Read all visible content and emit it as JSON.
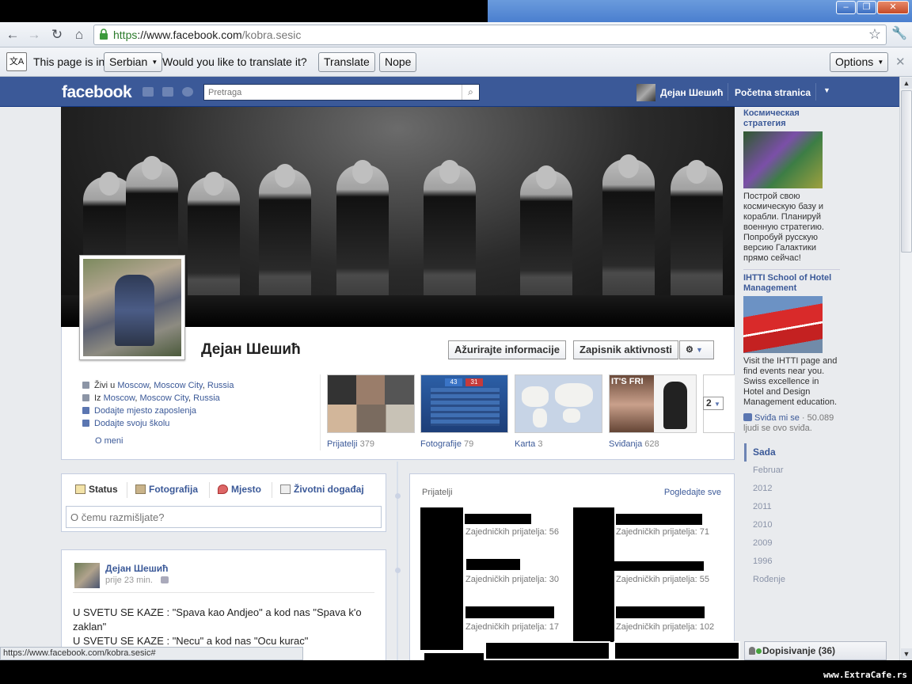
{
  "browser": {
    "url_scheme": "https",
    "url_sep": "://",
    "url_domain": "www.facebook.com",
    "url_path": "/kobra.sesic",
    "status_url": "https://www.facebook.com/kobra.sesic#"
  },
  "translate_bar": {
    "prefix": "This page is in",
    "language": "Serbian",
    "question": "Would you like to translate it?",
    "translate_label": "Translate",
    "nope_label": "Nope",
    "options_label": "Options"
  },
  "fb_header": {
    "logo": "facebook",
    "search_placeholder": "Pretraga",
    "user_name": "Дејан Шешић",
    "home_label": "Početna stranica"
  },
  "profile": {
    "name": "Дејан Шешић",
    "update_info_label": "Ažurirajte informacije",
    "activity_log_label": "Zapisnik aktivnosti",
    "lives_prefix": "Živi u",
    "lives_city": "Moscow",
    "lives_region": "Moscow City",
    "lives_country": "Russia",
    "from_prefix": "Iz",
    "from_city": "Moscow",
    "from_region": "Moscow City",
    "from_country": "Russia",
    "add_work": "Dodajte mjesto zaposlenja",
    "add_school": "Dodajte svoju školu",
    "about_link": "O meni",
    "tiles": [
      {
        "label": "Prijatelji",
        "count": "379"
      },
      {
        "label": "Fotografije",
        "count": "79"
      },
      {
        "label": "Karta",
        "count": "3"
      },
      {
        "label": "Sviđanja",
        "count": "628"
      }
    ],
    "more_count": "2",
    "photo_tile_score_a": "43",
    "photo_tile_score_b": "31",
    "likes_tile_text": "IT'S FRI"
  },
  "composer": {
    "tab_status": "Status",
    "tab_photo": "Fotografija",
    "tab_place": "Mjesto",
    "tab_event": "Životni događaj",
    "placeholder": "O čemu razmišljate?"
  },
  "post": {
    "author": "Дејан Шешић",
    "time": "prije 23 min.",
    "line1": "U SVETU SE KAZE : \"Spava kao Andjeo\" a kod nas \"Spava k'o zaklan\"",
    "line2": "U SVETU SE KAZE : \"Necu\" a kod nas \"Ocu kurac\""
  },
  "friends_box": {
    "title": "Prijatelji",
    "see_all": "Pogledajte sve",
    "mutual": [
      "Zajedničkih prijatelja: 56",
      "Zajedničkih prijatelja: 71",
      "Zajedničkih prijatelja: 30",
      "Zajedničkih prijatelja: 55",
      "Zajedničkih prijatelja: 17",
      "Zajedničkih prijatelja: 102"
    ]
  },
  "ads": [
    {
      "title": "Космическая стратегия",
      "body": "Построй свою космическую базу и корабли. Планируй военную стратегию. Попробуй русскую версию Галактики прямо сейчас!"
    },
    {
      "title": "IHTTI School of Hotel Management",
      "body": "Visit the IHTTI page and find events near you. Swiss excellence in Hotel and Design Management education.",
      "like_label": "Sviđa mi se",
      "like_suffix": "· 50.089 ljudi se ovo sviđa."
    }
  ],
  "timeline_years": [
    "Sada",
    "Februar",
    "2012",
    "2011",
    "2010",
    "2009",
    "1996",
    "Rođenje"
  ],
  "chat": {
    "label": "Dopisivanje (36)"
  },
  "watermark": "www.ExtraCafe.rs"
}
